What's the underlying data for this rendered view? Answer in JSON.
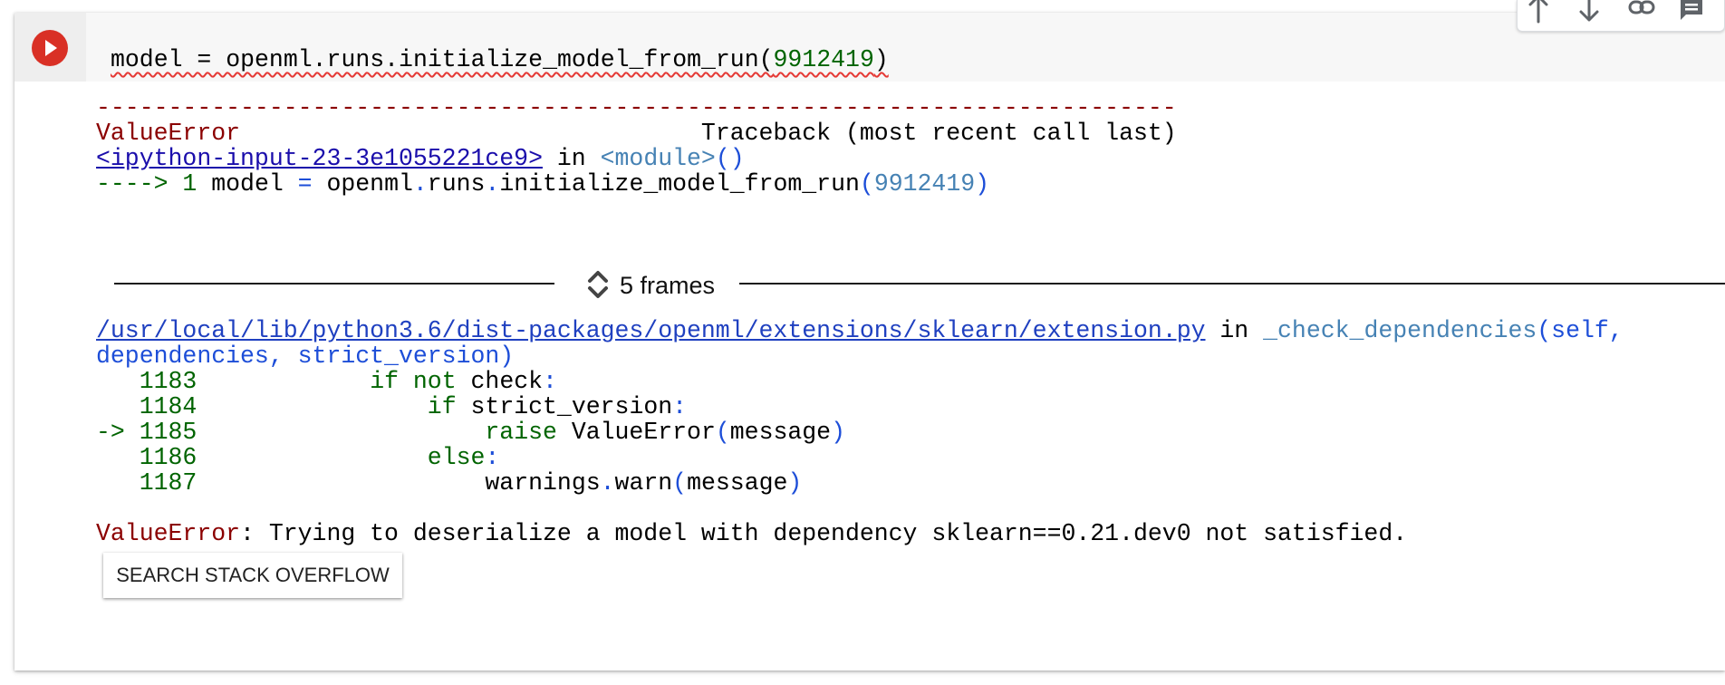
{
  "cell": {
    "input_code": "model = openml.runs.initialize_model_from_run(",
    "input_number": "9912419",
    "input_close": ")"
  },
  "toolbar": {
    "icons": [
      "move-up-icon",
      "move-down-icon",
      "link-icon",
      "comment-icon"
    ]
  },
  "traceback": {
    "separator": "---------------------------------------------------------------------------",
    "error_type": "ValueError",
    "header_spacer": "                                ",
    "header_right": "Traceback (most recent call last)",
    "input_link": "<ipython-input-23-3e1055221ce9>",
    "in_word": " in ",
    "module_name": "<module>",
    "module_parens": "()",
    "arrow_line_prefix": "----> 1 ",
    "arrow_line_code_a": "model ",
    "arrow_line_eq": "=",
    "arrow_line_code_b": " openml",
    "dot": ".",
    "runs": "runs",
    "func": "initialize_model_from_run",
    "open_paren": "(",
    "arg": "9912419",
    "close_paren": ")",
    "frames_label": "5 frames",
    "file_link": "/usr/local/lib/python3.6/dist-packages/openml/extensions/sklearn/extension.py",
    "file_in": " in ",
    "func_name": "_check_dependencies",
    "func_args_line1": "(self,",
    "func_args_line2": "dependencies, strict_version)",
    "code_lines": [
      {
        "prefix": "   ",
        "num": "1183",
        "indent": "            ",
        "kw": "if not",
        "rest": " check",
        "colon": ":"
      },
      {
        "prefix": "   ",
        "num": "1184",
        "indent": "                ",
        "kw": "if",
        "rest": " strict_version",
        "colon": ":"
      },
      {
        "prefix": "-> ",
        "num": "1185",
        "indent": "                    ",
        "kw": "raise",
        "rest": " ValueError",
        "paren_open": "(",
        "arg": "message",
        "paren_close": ")"
      },
      {
        "prefix": "   ",
        "num": "1186",
        "indent": "                ",
        "kw": "else",
        "colon": ":"
      },
      {
        "prefix": "   ",
        "num": "1187",
        "indent": "                    ",
        "obj": "warnings",
        "dot": ".",
        "meth": "warn",
        "paren_open": "(",
        "arg": "message",
        "paren_close": ")"
      }
    ],
    "final_error_type": "ValueError",
    "final_message": ": Trying to deserialize a model with dependency sklearn==0.21.dev0 not satisfied."
  },
  "search_button_label": "SEARCH STACK OVERFLOW",
  "colors": {
    "run_button": "#d93025",
    "error_red": "#8b0000",
    "green": "#006400",
    "blue": "#1d4ed8",
    "steel": "#4682b4"
  }
}
